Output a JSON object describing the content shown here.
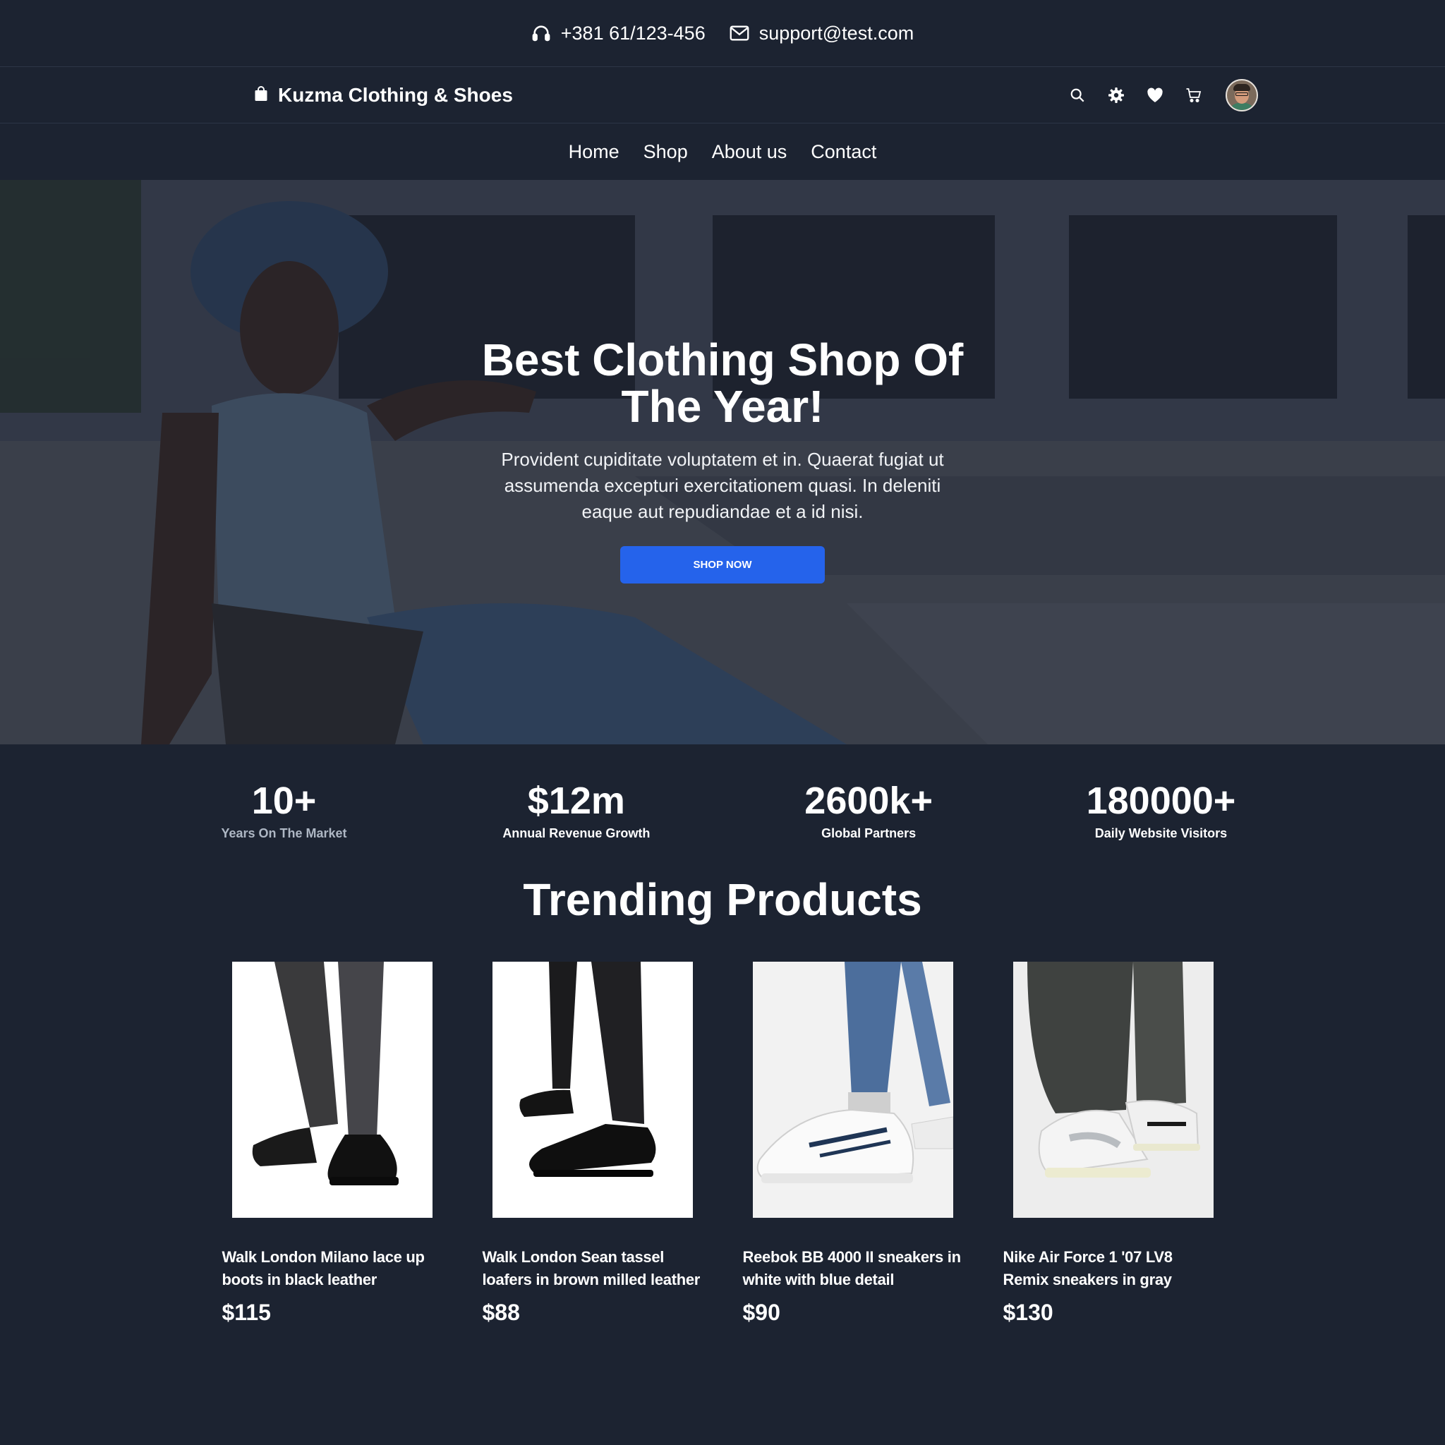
{
  "topbar": {
    "phone": "+381 61/123-456",
    "email": "support@test.com"
  },
  "header": {
    "brand": "Kuzma Clothing & Shoes",
    "icons": [
      "search-icon",
      "gear-icon",
      "heart-icon",
      "cart-icon"
    ]
  },
  "nav": {
    "items": [
      "Home",
      "Shop",
      "About us",
      "Contact"
    ]
  },
  "hero": {
    "title": "Best Clothing Shop Of The Year!",
    "text": "Provident cupiditate voluptatem et in. Quaerat fugiat ut assumenda excepturi exercitationem quasi. In deleniti eaque aut repudiandae et a id nisi.",
    "button": "SHOP NOW"
  },
  "stats": [
    {
      "value": "10+",
      "label": "Years On The Market"
    },
    {
      "value": "$12m",
      "label": "Annual Revenue Growth"
    },
    {
      "value": "2600k+",
      "label": "Global Partners"
    },
    {
      "value": "180000+",
      "label": "Daily Website Visitors"
    }
  ],
  "trending": {
    "title": "Trending Products",
    "products": [
      {
        "name": "Walk London Milano lace up boots in black leather",
        "price": "$115"
      },
      {
        "name": "Walk London Sean tassel loafers in brown milled leather",
        "price": "$88"
      },
      {
        "name": "Reebok BB 4000 II sneakers in white with blue detail",
        "price": "$90"
      },
      {
        "name": "Nike Air Force 1 '07 LV8 Remix sneakers in gray",
        "price": "$130"
      }
    ]
  },
  "colors": {
    "background": "#1c2331",
    "accent": "#2563eb",
    "text": "#ffffff"
  }
}
